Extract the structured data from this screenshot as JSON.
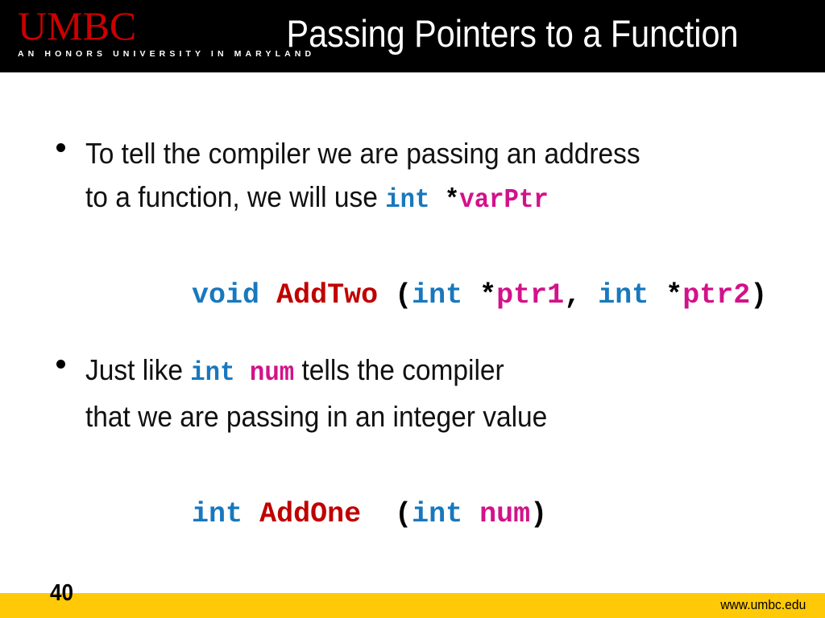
{
  "header": {
    "logo_word": "UMBC",
    "logo_tagline": "AN HONORS UNIVERSITY IN MARYLAND",
    "title": "Passing Pointers to a Function",
    "background_color": "#000000",
    "logo_color": "#CC0000",
    "title_color": "#FFFFFF"
  },
  "body": {
    "bullet1": {
      "line1_text": "To tell the compiler we are passing an address",
      "line2_prefix": "to a function, we will use ",
      "line2_code_type": "int",
      "line2_code_star": " *",
      "line2_code_var": "varPtr"
    },
    "code1": {
      "return_type": "void",
      "space1": " ",
      "name": "AddTwo",
      "space2": " ",
      "open_paren": "(",
      "param1_type": "int",
      "param1_space": " ",
      "param1_star": "*",
      "param1_name": "ptr1",
      "comma": ", ",
      "param2_type": "int",
      "param2_space": " ",
      "param2_star": "*",
      "param2_name": "ptr2",
      "close_paren": ")"
    },
    "bullet2": {
      "line1_prefix": "Just like ",
      "line1_code_type": "int",
      "line1_code_space": "  ",
      "line1_code_var": "num",
      "line1_suffix": "  tells the compiler",
      "line2_text": "that we are passing in an integer value"
    },
    "code2": {
      "return_type": "int",
      "space1": " ",
      "name": "AddOne",
      "space2": "  ",
      "open_paren": "(",
      "param1_type": "int",
      "param1_space": " ",
      "param1_name": "num",
      "close_paren": ")"
    },
    "colors": {
      "keyword_blue": "#1878BE",
      "identifier_pink": "#D2128A",
      "function_red": "#C00000",
      "punctuation_black": "#000000"
    }
  },
  "footer": {
    "slide_number": "40",
    "url": "www.umbc.edu",
    "bar_color": "#FFC907",
    "text_color": "#000000"
  }
}
